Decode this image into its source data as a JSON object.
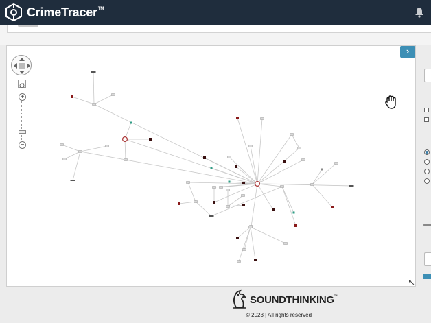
{
  "app": {
    "brand": "CrimeTracer",
    "trademark": "TM",
    "accent_color": "#3d8fb5",
    "header_color": "#1f2d3d"
  },
  "header": {
    "icons": [
      "crimetracer-logo-icon",
      "bell-icon"
    ]
  },
  "graph_controls": {
    "icons": [
      "pan-pad-icon",
      "reset-view-icon",
      "zoom-in-icon",
      "zoom-out-icon",
      "expand-panel-icon",
      "hand-cursor-icon",
      "resize-handle-icon"
    ],
    "zoom_in_label": "+",
    "zoom_out_label": "−",
    "expand_label": "›",
    "zoom_level": 0.22
  },
  "footer": {
    "company": "SOUNDTHINKING",
    "trademark": "™",
    "copyright": "© 2023 | All rights reserved"
  }
}
